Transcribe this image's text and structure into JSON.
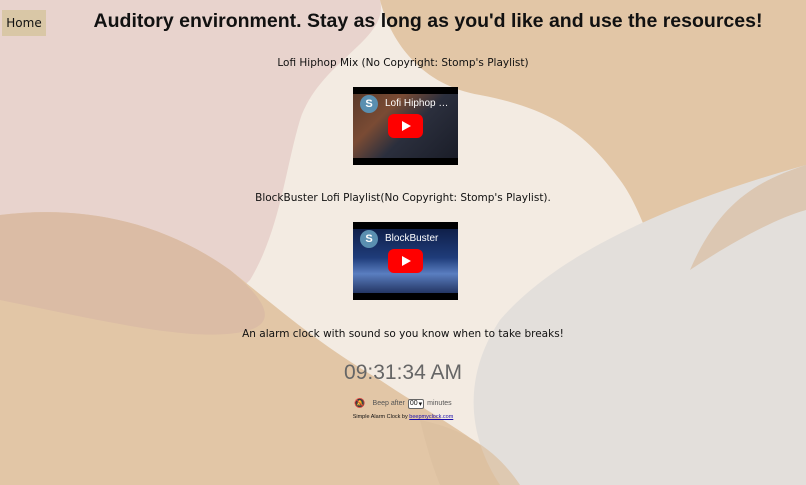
{
  "nav": {
    "home_label": "Home"
  },
  "page": {
    "title": "Auditory environment. Stay as long as you'd like and use the resources!"
  },
  "videos": [
    {
      "caption": "Lofi Hiphop Mix (No Copyright: Stomp's Playlist)",
      "thumb_title": "Lofi Hiphop M..."
    },
    {
      "caption": "BlockBuster Lofi Playlist(No Copyright: Stomp's Playlist).",
      "thumb_title": "BlockBuster"
    }
  ],
  "alarm": {
    "caption": "An alarm clock with sound so you know when to take breaks!",
    "time": "09:31:34 AM",
    "beep_prefix": "Beep after",
    "beep_value": "00",
    "beep_suffix": "minutes",
    "credit_prefix": "Simple Alarm Clock by",
    "credit_link": "beepmyclock.com"
  },
  "colors": {
    "background": "#f3ebe2",
    "blob_tan": "#e2c6a6",
    "blob_pink": "#e8d3cd",
    "blob_dusty": "#d8b8a4",
    "blob_grey": "#e3dfdb",
    "home_button": "#d9c7a6",
    "youtube_red": "#ff0000"
  }
}
